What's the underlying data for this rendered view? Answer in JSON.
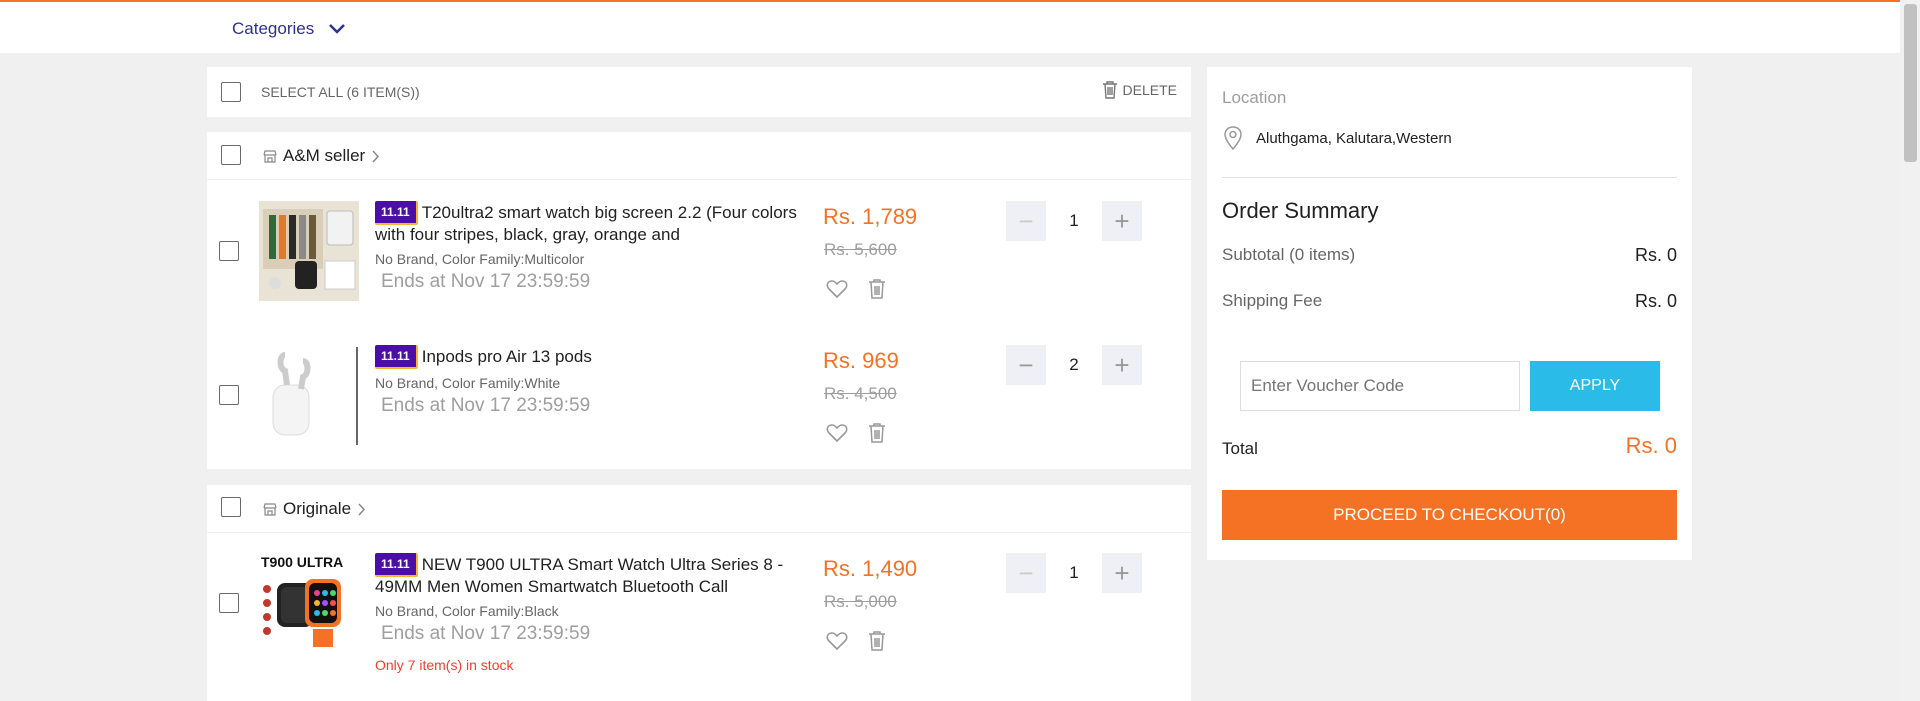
{
  "header": {
    "categories_label": "Categories"
  },
  "cart": {
    "select_all_label": "SELECT ALL (6 ITEM(S))",
    "delete_label": "DELETE",
    "stores": [
      {
        "name": "A&M seller",
        "items": [
          {
            "badge": "11.11",
            "title": "T20ultra2 smart watch big screen 2.2 (Four colors with four stripes, black, gray, orange and",
            "variant": "No Brand, Color Family:Multicolor",
            "ends": "Ends at Nov 17 23:59:59",
            "price": "Rs. 1,789",
            "old_price": "Rs. 5,600",
            "qty": "1"
          },
          {
            "badge": "11.11",
            "title": "Inpods pro Air 13 pods",
            "variant": "No Brand, Color Family:White",
            "ends": "Ends at Nov 17 23:59:59",
            "price": "Rs. 969",
            "old_price": "Rs. 4,500",
            "qty": "2"
          }
        ]
      },
      {
        "name": "Originale",
        "items": [
          {
            "badge": "11.11",
            "title": "NEW T900 ULTRA Smart Watch Ultra Series 8 - 49MM Men Women Smartwatch Bluetooth Call",
            "variant": "No Brand, Color Family:Black",
            "ends": "Ends at Nov 17 23:59:59",
            "stock": "Only 7 item(s) in stock",
            "price": "Rs. 1,490",
            "old_price": "Rs. 5,000",
            "qty": "1",
            "image_text": "T900 ULTRA"
          }
        ]
      }
    ]
  },
  "summary": {
    "location_title": "Location",
    "location": "Aluthgama, Kalutara,Western",
    "title": "Order Summary",
    "subtotal_label": "Subtotal (0 items)",
    "subtotal_value": "Rs. 0",
    "shipping_label": "Shipping Fee",
    "shipping_value": "Rs. 0",
    "voucher_placeholder": "Enter Voucher Code",
    "apply_label": "APPLY",
    "total_label": "Total",
    "total_value": "Rs. 0",
    "checkout_label": "PROCEED TO CHECKOUT(0)"
  },
  "colors": {
    "accent": "#f57224",
    "apply": "#2abbe8",
    "badge": "#4b0fa3",
    "link": "#2e3192"
  }
}
